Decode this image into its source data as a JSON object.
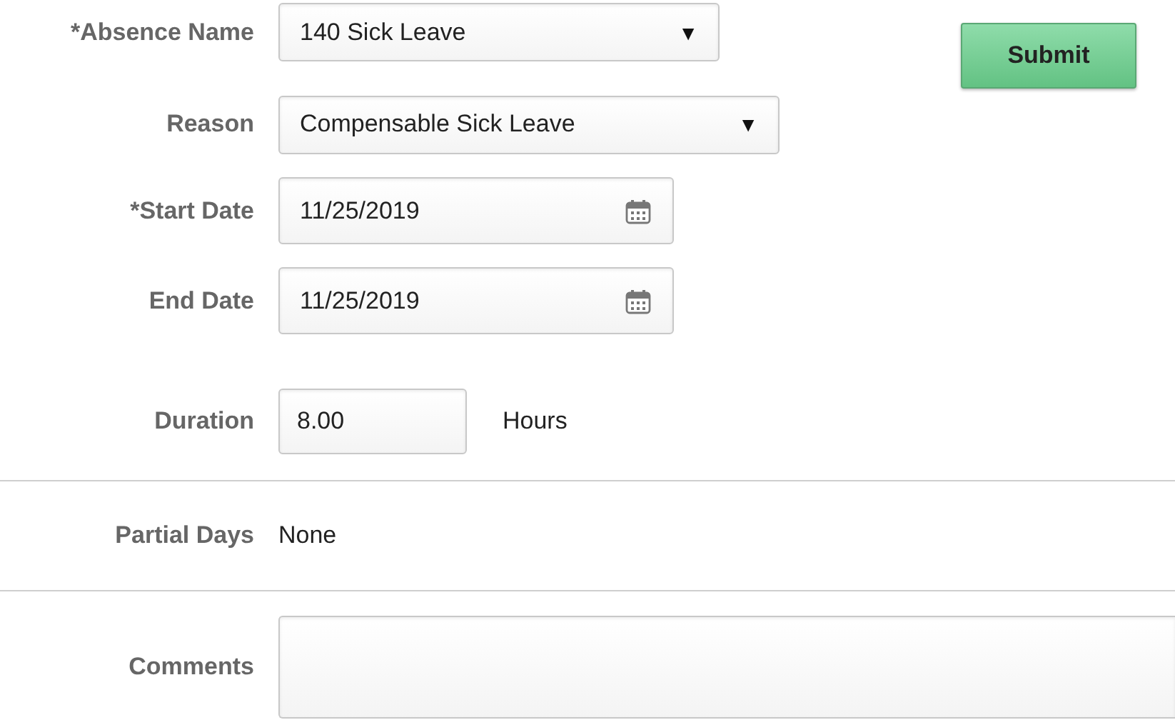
{
  "absence_name": {
    "label": "*Absence Name",
    "value": "140 Sick Leave",
    "caret": "▼"
  },
  "submit": {
    "label": "Submit"
  },
  "reason": {
    "label": "Reason",
    "value": "Compensable Sick Leave",
    "caret": "▼"
  },
  "start_date": {
    "label": "*Start Date",
    "value": "11/25/2019"
  },
  "end_date": {
    "label": "End Date",
    "value": "11/25/2019"
  },
  "duration": {
    "label": "Duration",
    "value": "8.00",
    "unit": "Hours"
  },
  "partial_days": {
    "label": "Partial Days",
    "value": "None"
  },
  "comments": {
    "label": "Comments"
  }
}
